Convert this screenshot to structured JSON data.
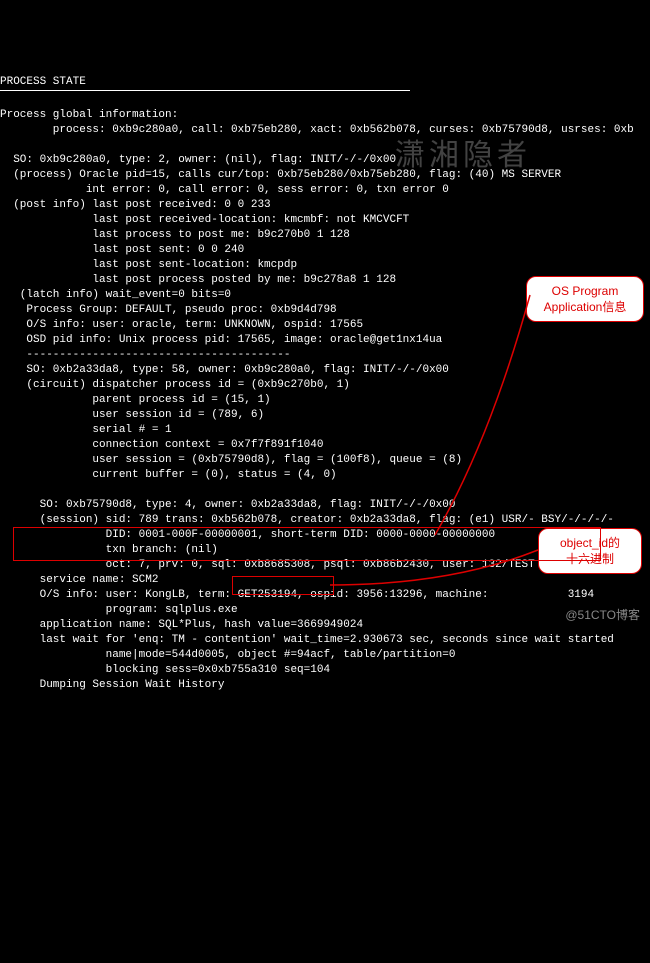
{
  "header": {
    "title": "PROCESS STATE",
    "underline": "----------------------------------------------------------"
  },
  "global": {
    "label": "Process global information:",
    "process_line": "        process: 0xb9c280a0, call: 0xb75eb280, xact: 0xb562b078, curses: 0xb75790d8, usrses: 0xb"
  },
  "so1": {
    "line1": "  SO: 0xb9c280a0, type: 2, owner: (nil), flag: INIT/-/-/0x00",
    "line2": "  (process) Oracle pid=15, calls cur/top: 0xb75eb280/0xb75eb280, flag: (40) MS SERVER",
    "line3": "             int error: 0, call error: 0, sess error: 0, txn error 0",
    "post1": "  (post info) last post received: 0 0 233",
    "post2": "              last post received-location: kmcmbf: not KMCVCFT",
    "post3": "              last process to post me: b9c270b0 1 128",
    "post4": "              last post sent: 0 0 240",
    "post5": "              last post sent-location: kmcpdp",
    "post6": "              last post process posted by me: b9c278a8 1 128",
    "latch": "   (latch info) wait_event=0 bits=0",
    "pgroup": "    Process Group: DEFAULT, pseudo proc: 0xb9d4d798",
    "osinfo": "    O/S info: user: oracle, term: UNKNOWN, ospid: 17565",
    "osd": "    OSD pid info: Unix process pid: 17565, image: oracle@get1nx14ua"
  },
  "so2": {
    "hline": "    ----------------------------------------",
    "line1": "    SO: 0xb2a33da8, type: 58, owner: 0xb9c280a0, flag: INIT/-/-/0x00",
    "circuit": "    (circuit) dispatcher process id = (0xb9c270b0, 1)",
    "parent": "              parent process id = (15, 1)",
    "usess": "              user session id = (789, 6)",
    "serial": "              serial # = 1",
    "conn": "              connection context = 0x7f7f891f1040",
    "usess2": "              user session = (0xb75790d8), flag = (100f8), queue = (8)",
    "curbuf": "              current buffer = (0), status = (4, 0)"
  },
  "so3": {
    "line1": "      SO: 0xb75790d8, type: 4, owner: 0xb2a33da8, flag: INIT/-/-/0x00",
    "sess": "      (session) sid: 789 trans: 0xb562b078, creator: 0xb2a33da8, flag: (e1) USR/- BSY/-/-/-/-",
    "did": "                DID: 0001-000F-00000001, short-term DID: 0000-0000-00000000",
    "txn": "                txn branch: (nil)",
    "oct": "                oct: 7, prv: 0, sql: 0xb8685308, psql: 0xb86b2430, user: 132/TEST",
    "svc": "      service name: SCM2",
    "os1": "      O/S info: user: KongLB, term: GET253194, ospid: 3956:13296, machine:            3194",
    "os2": "                program: sqlplus.exe",
    "app": "      application name: SQL*Plus, hash value=3669949024",
    "wait": "      last wait for 'enq: TM - contention' wait_time=2.930673 sec, seconds since wait started",
    "wait2": "                name|mode=544d0005, object #=94acf, table/partition=0",
    "wait3": "                blocking sess=0x0xb755a310 seq=104",
    "dump": "      Dumping Session Wait History"
  },
  "annot1": {
    "l1": "OS Program",
    "l2": "Application信息"
  },
  "annot2": {
    "l1": "object_id的",
    "l2": "十六进制"
  },
  "watermark": "潇湘隐者",
  "footer": "@51CTO博客"
}
